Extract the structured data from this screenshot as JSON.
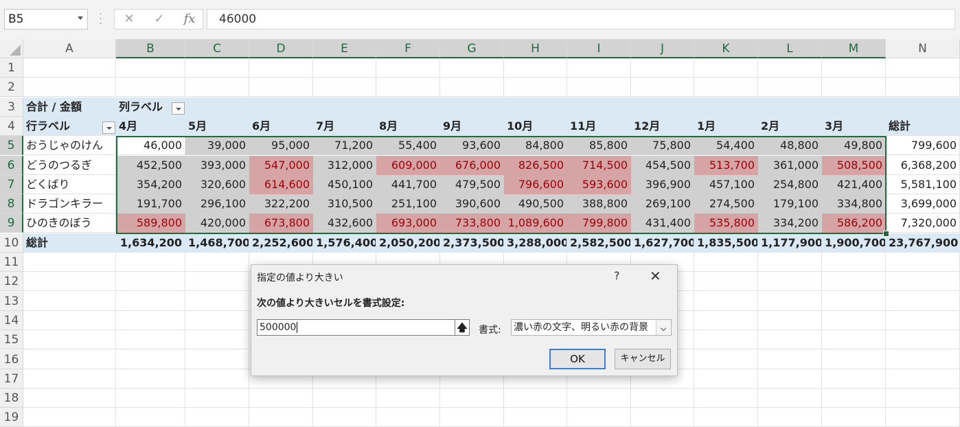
{
  "formula_bar": {
    "name_box": "B5",
    "cancel_icon": "✕",
    "enter_icon": "✓",
    "fx_label": "fx",
    "formula": "46000"
  },
  "columns": [
    "A",
    "B",
    "C",
    "D",
    "E",
    "F",
    "G",
    "H",
    "I",
    "J",
    "K",
    "L",
    "M",
    "N"
  ],
  "rows": [
    "1",
    "2",
    "3",
    "4",
    "5",
    "6",
    "7",
    "8",
    "9",
    "10",
    "11",
    "12",
    "13",
    "14",
    "15",
    "16",
    "17",
    "18",
    "19"
  ],
  "pivot": {
    "value_label": "合計 / 金額",
    "col_label": "列ラベル",
    "row_label": "行ラベル",
    "months": [
      "4月",
      "5月",
      "6月",
      "7月",
      "8月",
      "9月",
      "10月",
      "11月",
      "12月",
      "1月",
      "2月",
      "3月"
    ],
    "grand_total_label": "総計",
    "data": [
      {
        "name": "おうじゃのけん",
        "values": [
          "46,000",
          "39,000",
          "95,000",
          "71,200",
          "55,400",
          "93,600",
          "84,800",
          "85,800",
          "75,800",
          "54,400",
          "48,800",
          "49,800"
        ],
        "total": "799,600"
      },
      {
        "name": "どうのつるぎ",
        "values": [
          "452,500",
          "393,000",
          "547,000",
          "312,000",
          "609,000",
          "676,000",
          "826,500",
          "714,500",
          "454,500",
          "513,700",
          "361,000",
          "508,500"
        ],
        "total": "6,368,200"
      },
      {
        "name": "どくばり",
        "values": [
          "354,200",
          "320,600",
          "614,600",
          "450,100",
          "441,700",
          "479,500",
          "796,600",
          "593,600",
          "396,900",
          "457,100",
          "254,800",
          "421,400"
        ],
        "total": "5,581,100"
      },
      {
        "name": "ドラゴンキラー",
        "values": [
          "191,700",
          "296,100",
          "322,200",
          "310,500",
          "251,100",
          "390,600",
          "490,500",
          "388,800",
          "269,100",
          "274,500",
          "179,100",
          "334,800"
        ],
        "total": "3,699,000"
      },
      {
        "name": "ひのきのぼう",
        "values": [
          "589,800",
          "420,000",
          "673,800",
          "432,600",
          "693,000",
          "733,800",
          "1,089,600",
          "799,800",
          "431,400",
          "535,800",
          "334,200",
          "586,200"
        ],
        "total": "7,320,000"
      }
    ],
    "totals": [
      "1,634,200",
      "1,468,700",
      "2,252,600",
      "1,576,400",
      "2,050,200",
      "2,373,500",
      "3,288,000",
      "2,582,500",
      "1,627,700",
      "1,835,500",
      "1,177,900",
      "1,900,700"
    ],
    "grand_total": "23,767,900"
  },
  "dialog": {
    "title": "指定の値より大きい",
    "help": "?",
    "close": "✕",
    "prompt": "次の値より大きいセルを書式設定:",
    "input_value": "500000",
    "collapse_icon": "🡅",
    "format_label": "書式:",
    "format_value": "濃い赤の文字、明るい赤の背景",
    "ok_label": "OK",
    "cancel_label": "キャンセル"
  },
  "colors": {
    "highlight_bg": "#d7a4a6",
    "highlight_text": "#9c0006",
    "selection_bg": "#d0d0d0",
    "pivot_band": "#dbe9f5",
    "excel_green": "#1d6b3c"
  }
}
